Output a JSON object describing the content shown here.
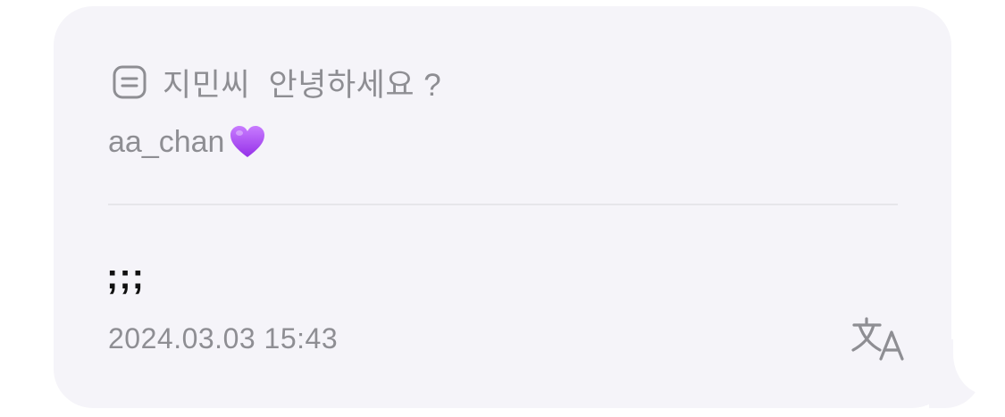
{
  "reply": {
    "icon": "quote-reply-icon",
    "text": "지민씨  안녕하세요 ?",
    "sender": "aa_chan",
    "sender_emoji": "purple-heart-icon",
    "emoji_color": "#a64df5"
  },
  "message": {
    "text": ";;;",
    "timestamp": "2024.03.03 15:43"
  },
  "actions": {
    "translate_icon": "translate-icon"
  },
  "colors": {
    "bubble": "#f5f4f9",
    "secondary_text": "#8e8e93",
    "primary_text": "#111111"
  }
}
